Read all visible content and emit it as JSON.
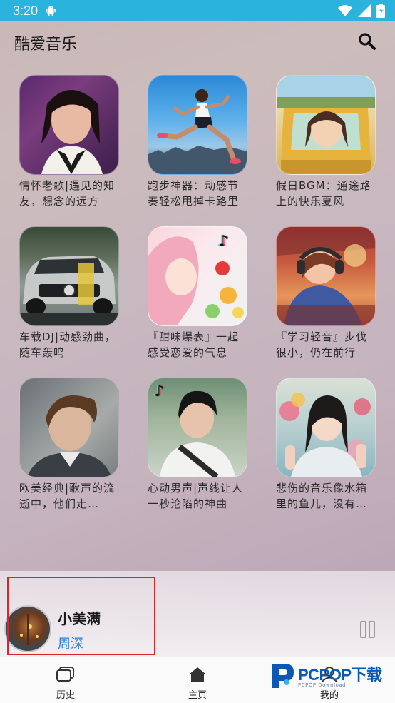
{
  "status": {
    "time": "3:20"
  },
  "app": {
    "title": "酷爱音乐"
  },
  "playlists": [
    {
      "caption": "情怀老歌|遇见的知友，想念的远方"
    },
    {
      "caption": "跑步神器：动感节奏轻松甩掉卡路里"
    },
    {
      "caption": "假日BGM：通途路上的快乐夏风"
    },
    {
      "caption": "车载DJ|动感劲曲，随车轰鸣"
    },
    {
      "caption": "『甜味爆表』一起感受恋爱的气息"
    },
    {
      "caption": "『学习轻音』步伐很小，仍在前行"
    },
    {
      "caption": "欧美经典|歌声的流逝中，他们走…"
    },
    {
      "caption": "心动男声|声线让人一秒沦陷的神曲"
    },
    {
      "caption": "悲伤的音乐像水箱里的鱼儿，没有…"
    }
  ],
  "player": {
    "song": "小美满",
    "artist": "周深"
  },
  "nav": {
    "history": "历史",
    "home": "主页",
    "mine": "我的"
  },
  "watermark": {
    "brand": "PCPOP下载",
    "sub": "PCPOP Download"
  },
  "colors": {
    "statusbar": "#2ab3dd",
    "artist": "#2a7fe0",
    "highlight_box": "#d8262b"
  }
}
